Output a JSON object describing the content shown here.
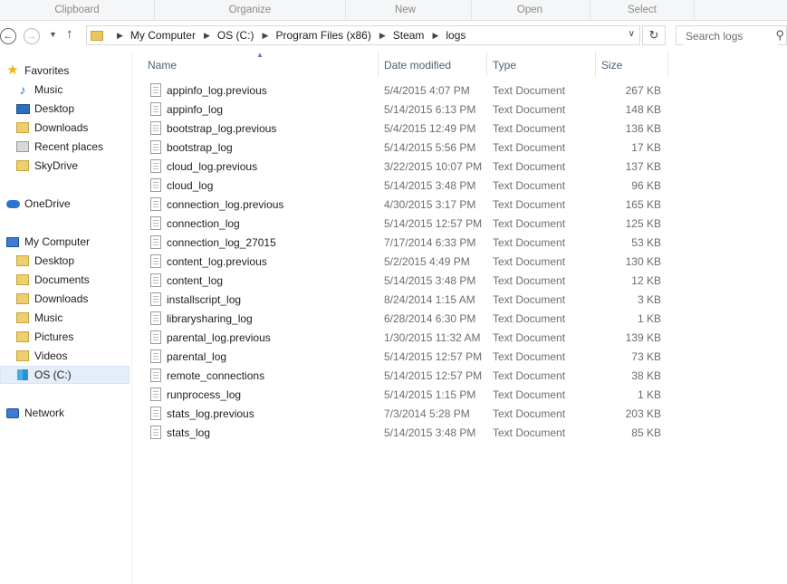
{
  "ribbon": {
    "groups": [
      "Clipboard",
      "Organize",
      "New",
      "Open",
      "Select"
    ]
  },
  "navigation": {
    "back_icon": "back-arrow-icon",
    "forward_icon": "forward-arrow-icon",
    "up_icon": "up-arrow-icon",
    "breadcrumb": [
      "My Computer",
      "OS (C:)",
      "Program Files (x86)",
      "Steam",
      "logs"
    ],
    "search_placeholder": "Search logs"
  },
  "sidebar": {
    "favorites": {
      "label": "Favorites",
      "items": [
        "Music",
        "Desktop",
        "Downloads",
        "Recent places",
        "SkyDrive"
      ]
    },
    "onedrive": {
      "label": "OneDrive"
    },
    "computer": {
      "label": "My Computer",
      "items": [
        "Desktop",
        "Documents",
        "Downloads",
        "Music",
        "Pictures",
        "Videos",
        "OS (C:)"
      ],
      "selected": "OS (C:)"
    },
    "network": {
      "label": "Network"
    }
  },
  "columns": {
    "name": "Name",
    "date": "Date modified",
    "type": "Type",
    "size": "Size"
  },
  "files": [
    {
      "name": "appinfo_log.previous",
      "date": "5/4/2015 4:07 PM",
      "type": "Text Document",
      "size": "267 KB"
    },
    {
      "name": "appinfo_log",
      "date": "5/14/2015 6:13 PM",
      "type": "Text Document",
      "size": "148 KB"
    },
    {
      "name": "bootstrap_log.previous",
      "date": "5/4/2015 12:49 PM",
      "type": "Text Document",
      "size": "136 KB"
    },
    {
      "name": "bootstrap_log",
      "date": "5/14/2015 5:56 PM",
      "type": "Text Document",
      "size": "17 KB"
    },
    {
      "name": "cloud_log.previous",
      "date": "3/22/2015 10:07 PM",
      "type": "Text Document",
      "size": "137 KB"
    },
    {
      "name": "cloud_log",
      "date": "5/14/2015 3:48 PM",
      "type": "Text Document",
      "size": "96 KB"
    },
    {
      "name": "connection_log.previous",
      "date": "4/30/2015 3:17 PM",
      "type": "Text Document",
      "size": "165 KB"
    },
    {
      "name": "connection_log",
      "date": "5/14/2015 12:57 PM",
      "type": "Text Document",
      "size": "125 KB"
    },
    {
      "name": "connection_log_27015",
      "date": "7/17/2014 6:33 PM",
      "type": "Text Document",
      "size": "53 KB"
    },
    {
      "name": "content_log.previous",
      "date": "5/2/2015 4:49 PM",
      "type": "Text Document",
      "size": "130 KB"
    },
    {
      "name": "content_log",
      "date": "5/14/2015 3:48 PM",
      "type": "Text Document",
      "size": "12 KB"
    },
    {
      "name": "installscript_log",
      "date": "8/24/2014 1:15 AM",
      "type": "Text Document",
      "size": "3 KB"
    },
    {
      "name": "librarysharing_log",
      "date": "6/28/2014 6:30 PM",
      "type": "Text Document",
      "size": "1 KB"
    },
    {
      "name": "parental_log.previous",
      "date": "1/30/2015 11:32 AM",
      "type": "Text Document",
      "size": "139 KB"
    },
    {
      "name": "parental_log",
      "date": "5/14/2015 12:57 PM",
      "type": "Text Document",
      "size": "73 KB"
    },
    {
      "name": "remote_connections",
      "date": "5/14/2015 12:57 PM",
      "type": "Text Document",
      "size": "38 KB"
    },
    {
      "name": "runprocess_log",
      "date": "5/14/2015 1:15 PM",
      "type": "Text Document",
      "size": "1 KB"
    },
    {
      "name": "stats_log.previous",
      "date": "7/3/2014 5:28 PM",
      "type": "Text Document",
      "size": "203 KB"
    },
    {
      "name": "stats_log",
      "date": "5/14/2015 3:48 PM",
      "type": "Text Document",
      "size": "85 KB"
    }
  ]
}
